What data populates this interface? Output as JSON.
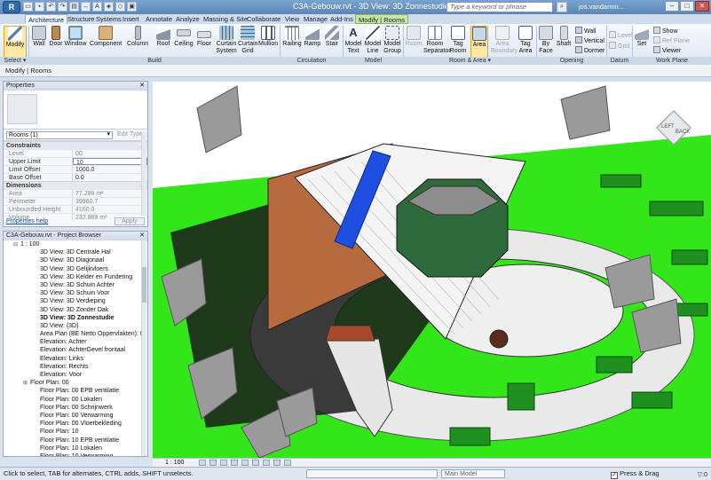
{
  "titlebar": {
    "app_button": "R",
    "title": "C3A-Gebouw.rvt - 3D View: 3D Zonnestudie",
    "search_placeholder": "Type a keyword or phrase",
    "user": "jos.vandamm...",
    "minimize": "–",
    "maximize": "□",
    "close": "✕"
  },
  "tabs": [
    {
      "label": "Architecture",
      "active": true
    },
    {
      "label": "Structure"
    },
    {
      "label": "Systems"
    },
    {
      "label": "Insert"
    },
    {
      "label": "Annotate"
    },
    {
      "label": "Analyze"
    },
    {
      "label": "Massing & Site"
    },
    {
      "label": "Collaborate"
    },
    {
      "label": "View"
    },
    {
      "label": "Manage"
    },
    {
      "label": "Add-Ins"
    },
    {
      "label": "Modify | Rooms",
      "contextual": true
    }
  ],
  "ribbon": {
    "select": {
      "modify": "Modify",
      "group": "Select ▾"
    },
    "build": {
      "wall": "Wall",
      "door": "Door",
      "window": "Window",
      "component": "Component",
      "column": "Column",
      "roof": "Roof",
      "ceiling": "Ceiling",
      "floor": "Floor",
      "curtain_system": "Curtain System",
      "curtain_grid": "Curtain Grid",
      "mullion": "Mullion",
      "group": "Build"
    },
    "circulation": {
      "railing": "Railing",
      "ramp": "Ramp",
      "stair": "Stair",
      "group": "Circulation"
    },
    "model": {
      "model_text": "Model Text",
      "model_line": "Model Line",
      "model_group": "Model Group",
      "group": "Model"
    },
    "room_area": {
      "room": "Room",
      "room_separator": "Room Separator",
      "tag_room": "Tag Room",
      "area": "Area",
      "area_boundary": "Area Boundary",
      "tag_area": "Tag Area",
      "group": "Room & Area ▾"
    },
    "opening": {
      "by_face": "By Face",
      "shaft": "Shaft",
      "wall": "Wall",
      "vertical": "Vertical",
      "dormer": "Dormer",
      "group": "Opening"
    },
    "datum": {
      "level": "Level",
      "grid": "Grid",
      "group": "Datum"
    },
    "work_plane": {
      "set": "Set",
      "show": "Show",
      "ref_plane": "Ref Plane",
      "viewer": "Viewer",
      "group": "Work Plane"
    }
  },
  "options_bar": {
    "text": "Modify | Rooms"
  },
  "properties": {
    "title": "Properties",
    "type_selector": "Rooms (1)",
    "edit_type": "Edit Type",
    "sections": [
      {
        "name": "Constraints",
        "rows": [
          {
            "key": "Level",
            "value": "00",
            "readonly": true
          },
          {
            "key": "Upper Limit",
            "value": "10",
            "editing": true
          },
          {
            "key": "Limit Offset",
            "value": "1000.0"
          },
          {
            "key": "Base Offset",
            "value": "0.0"
          }
        ]
      },
      {
        "name": "Dimensions",
        "rows": [
          {
            "key": "Area",
            "value": "77.288 m²",
            "readonly": true
          },
          {
            "key": "Perimeter",
            "value": "39960.7",
            "readonly": true
          },
          {
            "key": "Unbounded Height",
            "value": "4160.0",
            "readonly": true
          },
          {
            "key": "Volume",
            "value": "232.869 m³",
            "readonly": true
          }
        ]
      }
    ],
    "help": "Properties help",
    "apply": "Apply"
  },
  "browser": {
    "title": "C3A-Gebouw.rvt - Project Browser",
    "items": [
      {
        "label": "1 : 100",
        "indent": 1,
        "toggle": "⊟"
      },
      {
        "label": "3D View: 3D Centrale Hal",
        "indent": 3
      },
      {
        "label": "3D View: 3D Diagonaal",
        "indent": 3
      },
      {
        "label": "3D View: 3D Gelijkvloers",
        "indent": 3
      },
      {
        "label": "3D View: 3D Kelder en Fundering",
        "indent": 3
      },
      {
        "label": "3D View: 3D Schuin Achter",
        "indent": 3
      },
      {
        "label": "3D View: 3D Schuin Voor",
        "indent": 3
      },
      {
        "label": "3D View: 3D Verdieping",
        "indent": 3
      },
      {
        "label": "3D View: 3D Zonder Dak",
        "indent": 3
      },
      {
        "label": "3D View: 3D Zonnestudie",
        "indent": 3,
        "selected": true
      },
      {
        "label": "3D View: {3D}",
        "indent": 3
      },
      {
        "label": "Area Plan (BE Netto Oppervlakten): Hemelwat",
        "indent": 3
      },
      {
        "label": "Elevation: Achter",
        "indent": 3
      },
      {
        "label": "Elevation: AchterGevel frontaal",
        "indent": 3
      },
      {
        "label": "Elevation: Links",
        "indent": 3
      },
      {
        "label": "Elevation: Rechts",
        "indent": 3
      },
      {
        "label": "Elevation: Voor",
        "indent": 3
      },
      {
        "label": "Floor Plan: 00",
        "indent": 2,
        "toggle": "⊞"
      },
      {
        "label": "Floor Plan: 00 EPB ventilatie",
        "indent": 3
      },
      {
        "label": "Floor Plan: 00 Lokalen",
        "indent": 3
      },
      {
        "label": "Floor Plan: 00 Schrijnwerk",
        "indent": 3
      },
      {
        "label": "Floor Plan: 00 Verwarming",
        "indent": 3
      },
      {
        "label": "Floor Plan: 00 Vloerbekleding",
        "indent": 3
      },
      {
        "label": "Floor Plan: 10",
        "indent": 3
      },
      {
        "label": "Floor Plan: 10 EPB ventilatie",
        "indent": 3
      },
      {
        "label": "Floor Plan: 10 Lokalen",
        "indent": 3
      },
      {
        "label": "Floor Plan: 10 Verwarming",
        "indent": 3
      }
    ]
  },
  "viewcube": {
    "left": "LEFT",
    "back": "BACK"
  },
  "view_control": {
    "scale": "1 : 100"
  },
  "status": {
    "message": "Click to select, TAB for alternates, CTRL adds, SHIFT unselects.",
    "model": "Main Model",
    "press_drag": "Press & Drag",
    "filter": "▽:0"
  },
  "colors": {
    "ribbon_selected": "#ffe7a4",
    "lawn": "#33e61a",
    "hedge": "#1f8f1f",
    "solar_panel": "#1e4fe0",
    "tree_gray": "#9a9a9a",
    "shadow": "#1a1a1a"
  }
}
